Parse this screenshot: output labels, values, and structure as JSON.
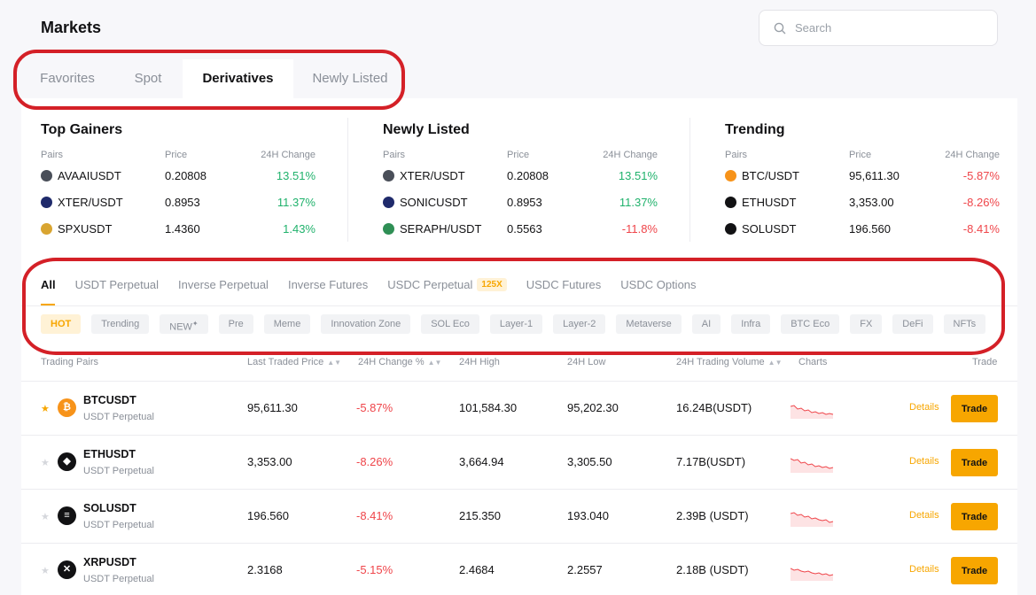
{
  "header": {
    "title": "Markets",
    "search_placeholder": "Search"
  },
  "main_tabs": [
    "Favorites",
    "Spot",
    "Derivatives",
    "Newly Listed"
  ],
  "active_main_tab": "Derivatives",
  "summary": [
    {
      "title": "Top Gainers",
      "headers": {
        "pairs": "Pairs",
        "price": "Price",
        "change": "24H Change"
      },
      "rows": [
        {
          "icon": "avaai-coin-icon",
          "color": "#4a4f59",
          "pair": "AVAAIUSDT",
          "price": "0.20808",
          "change": "13.51%",
          "dir": "up"
        },
        {
          "icon": "xter-coin-icon",
          "color": "#1f2a6b",
          "pair": "XTER/USDT",
          "price": "0.8953",
          "change": "11.37%",
          "dir": "up"
        },
        {
          "icon": "spx-coin-icon",
          "color": "#d9a531",
          "pair": "SPXUSDT",
          "price": "1.4360",
          "change": "1.43%",
          "dir": "up"
        }
      ]
    },
    {
      "title": "Newly Listed",
      "headers": {
        "pairs": "Pairs",
        "price": "Price",
        "change": "24H Change"
      },
      "rows": [
        {
          "icon": "xter-coin-icon",
          "color": "#4a4f59",
          "pair": "XTER/USDT",
          "price": "0.20808",
          "change": "13.51%",
          "dir": "up"
        },
        {
          "icon": "sonic-coin-icon",
          "color": "#1f2a6b",
          "pair": "SONICUSDT",
          "price": "0.8953",
          "change": "11.37%",
          "dir": "up"
        },
        {
          "icon": "seraph-coin-icon",
          "color": "#2f8f55",
          "pair": "SERAPH/USDT",
          "price": "0.5563",
          "change": "-11.8%",
          "dir": "down"
        }
      ]
    },
    {
      "title": "Trending",
      "headers": {
        "pairs": "Pairs",
        "price": "Price",
        "change": "24H Change"
      },
      "rows": [
        {
          "icon": "btc-coin-icon",
          "color": "#f7931a",
          "pair": "BTC/USDT",
          "price": "95,611.30",
          "change": "-5.87%",
          "dir": "down"
        },
        {
          "icon": "eth-coin-icon",
          "color": "#121214",
          "pair": "ETHUSDT",
          "price": "3,353.00",
          "change": "-8.26%",
          "dir": "down"
        },
        {
          "icon": "sol-coin-icon",
          "color": "#121214",
          "pair": "SOLUSDT",
          "price": "196.560",
          "change": "-8.41%",
          "dir": "down"
        }
      ]
    }
  ],
  "sub_tabs": [
    "All",
    "USDT Perpetual",
    "Inverse Perpetual",
    "Inverse Futures",
    "USDC Perpetual",
    "USDC Futures",
    "USDC Options"
  ],
  "sub_tab_badge": "125X",
  "active_sub_tab": "All",
  "chips": [
    "HOT",
    "Trending",
    "NEW",
    "Pre",
    "Meme",
    "Innovation Zone",
    "SOL Eco",
    "Layer-1",
    "Layer-2",
    "Metaverse",
    "AI",
    "Infra",
    "BTC Eco",
    "FX",
    "DeFi",
    "NFTs"
  ],
  "table": {
    "headers": {
      "pair": "Trading Pairs",
      "last_price": "Last Traded Price",
      "change": "24H Change %",
      "high": "24H High",
      "low": "24H Low",
      "volume": "24H Trading Volume",
      "charts": "Charts",
      "trade": "Trade"
    },
    "details_label": "Details",
    "trade_label": "Trade",
    "rows": [
      {
        "favorite": true,
        "icon": "btc-coin-icon",
        "color": "#f7931a",
        "glyph": "₿",
        "symbol": "BTCUSDT",
        "type": "USDT Perpetual",
        "last_price": "95,611.30",
        "change": "-5.87%",
        "high": "101,584.30",
        "low": "95,202.30",
        "volume": "16.24B(USDT)"
      },
      {
        "favorite": false,
        "icon": "eth-coin-icon",
        "color": "#121214",
        "glyph": "◆",
        "symbol": "ETHUSDT",
        "type": "USDT Perpetual",
        "last_price": "3,353.00",
        "change": "-8.26%",
        "high": "3,664.94",
        "low": "3,305.50",
        "volume": "7.17B(USDT)"
      },
      {
        "favorite": false,
        "icon": "sol-coin-icon",
        "color": "#121214",
        "glyph": "≡",
        "symbol": "SOLUSDT",
        "type": "USDT Perpetual",
        "last_price": "196.560",
        "change": "-8.41%",
        "high": "215.350",
        "low": "193.040",
        "volume": "2.39B (USDT)"
      },
      {
        "favorite": false,
        "icon": "xrp-coin-icon",
        "color": "#121214",
        "glyph": "✕",
        "symbol": "XRPUSDT",
        "type": "USDT Perpetual",
        "last_price": "2.3168",
        "change": "-5.15%",
        "high": "2.4684",
        "low": "2.2557",
        "volume": "2.18B (USDT)"
      }
    ]
  },
  "colors": {
    "accent": "#f7a600",
    "up": "#20b26c",
    "down": "#ef454a",
    "annotation": "#d42027"
  }
}
